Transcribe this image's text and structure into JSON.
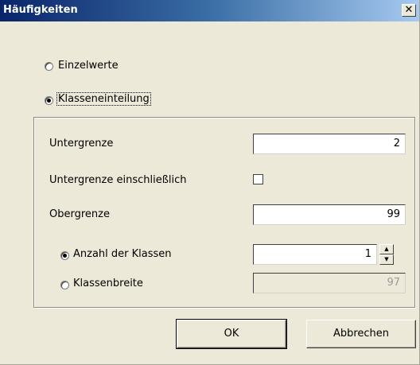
{
  "window": {
    "title": "Häufigkeiten",
    "close_glyph": "✕"
  },
  "mode": {
    "option_single": "Einzelwerte",
    "option_classes": "Klasseneinteilung",
    "selected": "Klasseneinteilung"
  },
  "classes": {
    "lower_bound_label": "Untergrenze",
    "lower_bound_value": "2",
    "lower_inclusive_label": "Untergrenze einschließlich",
    "lower_inclusive_checked": false,
    "upper_bound_label": "Obergrenze",
    "upper_bound_value": "99",
    "count_label": "Anzahl der Klassen",
    "count_value": "1",
    "width_label": "Klassenbreite",
    "width_value": "97",
    "selected_method": "Anzahl der Klassen"
  },
  "buttons": {
    "ok_label": "OK",
    "cancel_label": "Abbrechen"
  },
  "icons": {
    "close": "close-icon",
    "spin_up": "up-arrow-icon",
    "spin_down": "down-arrow-icon"
  }
}
